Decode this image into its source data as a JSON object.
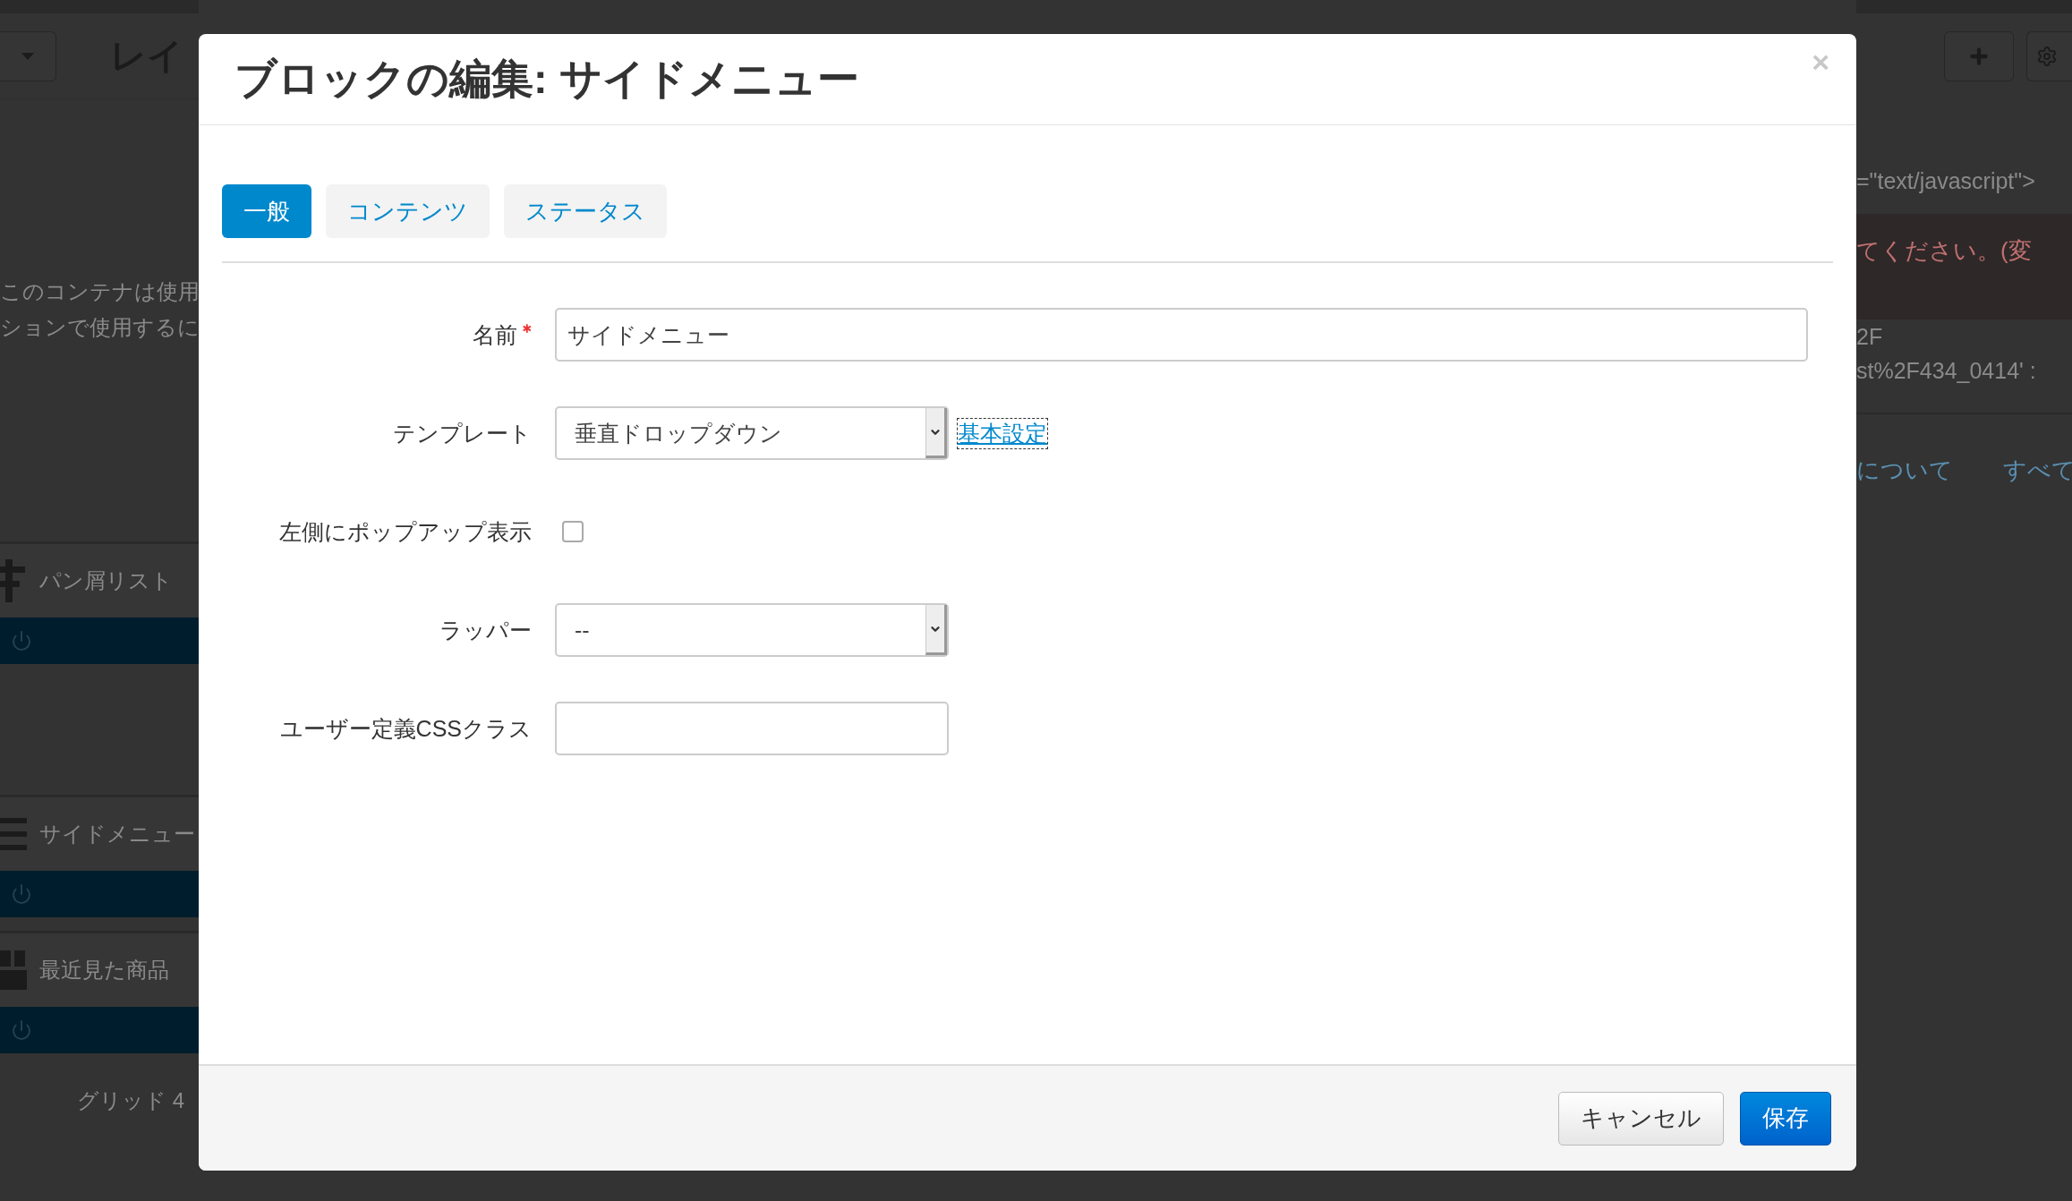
{
  "background": {
    "heading": "レイ",
    "notice_lines": [
      "このコンテナは使用",
      "ションで使用するに"
    ],
    "blocks": [
      {
        "title": "パン屑リスト",
        "kind": "signpost"
      },
      {
        "title": "サイドメニュー",
        "kind": "list"
      },
      {
        "title": "最近見た商品",
        "kind": "boxes"
      }
    ],
    "grid_label": "グリッド 4",
    "code_line": "=\"text/javascript\">",
    "alert_text": "てください。(変",
    "code_lines": [
      "2F",
      "st%2F434_0414' :"
    ],
    "links": [
      "について",
      "すべて"
    ]
  },
  "dialog": {
    "title": "ブロックの編集: サイドメニュー",
    "close": "×",
    "tabs": [
      {
        "label": "一般",
        "selected": true
      },
      {
        "label": "コンテンツ",
        "selected": false
      },
      {
        "label": "ステータス",
        "selected": false
      }
    ],
    "fields": [
      {
        "kind": "text",
        "label": "名前",
        "required": true,
        "value": "サイドメニュー",
        "wide": true
      },
      {
        "kind": "select",
        "label": "テンプレート",
        "required": false,
        "value": "垂直ドロップダウン",
        "link": "基本設定"
      },
      {
        "kind": "checkbox",
        "label": "左側にポップアップ表示",
        "required": false,
        "checked": false
      },
      {
        "kind": "select",
        "label": "ラッパー",
        "required": false,
        "value": "--"
      },
      {
        "kind": "text",
        "label": "ユーザー定義CSSクラス",
        "required": false,
        "wide": false
      }
    ],
    "buttons": [
      {
        "label": "キャンセル",
        "primary": false
      },
      {
        "label": "保存",
        "primary": true
      }
    ]
  }
}
